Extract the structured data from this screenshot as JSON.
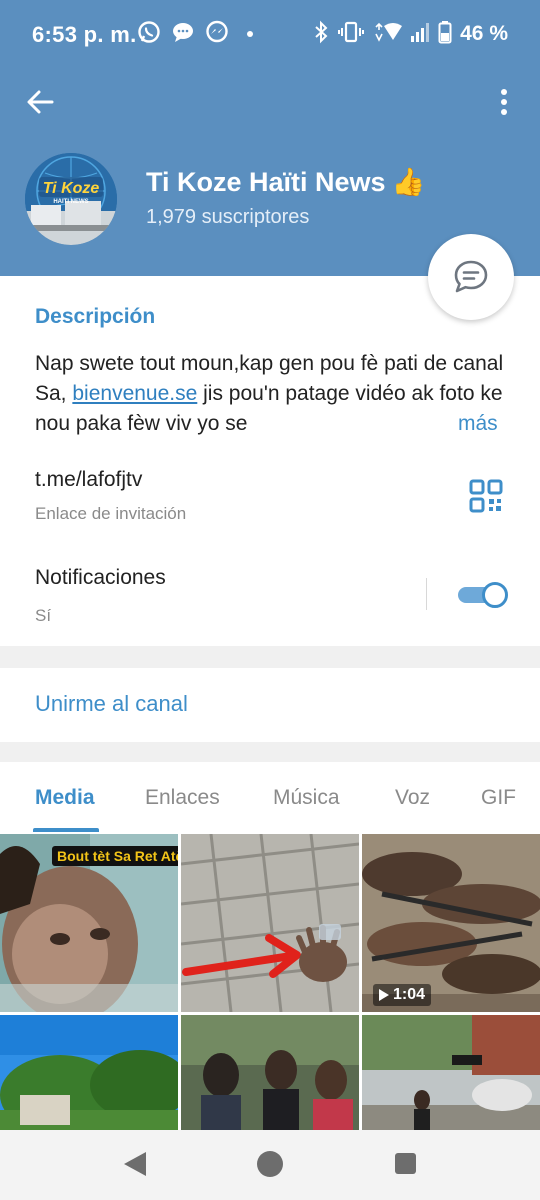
{
  "status_bar": {
    "time": "6:53 p. m.",
    "battery_percent": "46 %",
    "icons_left": [
      "whatsapp-icon",
      "chat-bubble-icon",
      "messenger-icon",
      "notification-dot"
    ],
    "icons_right": [
      "bluetooth-icon",
      "vibrate-icon",
      "wifi-icon",
      "signal-icon",
      "battery-icon"
    ]
  },
  "header": {
    "channel_name": "Ti Koze Haïti News",
    "channel_emoji": "👍",
    "subscribers": "1,979 suscriptores",
    "avatar_text": "Ti Koze",
    "avatar_subtext": "HAITI NEWS",
    "color": "#5b8fbf"
  },
  "description": {
    "label": "Descripción",
    "text_before_link": "Nap swete tout moun,kap gen pou fè pati de canal Sa, ",
    "link_text": "bienvenue.se",
    "text_after_link": " jis pou'n patage vidéo ak foto ke nou paka fèw viv yo se",
    "more": "más"
  },
  "invite": {
    "link": "t.me/lafofjtv",
    "label": "Enlace de invitación"
  },
  "notifications": {
    "title": "Notificaciones",
    "value": "Sí",
    "enabled": true
  },
  "join": {
    "label": "Unirme al canal"
  },
  "tabs": [
    {
      "label": "Media",
      "active": true
    },
    {
      "label": "Enlaces",
      "active": false
    },
    {
      "label": "Música",
      "active": false
    },
    {
      "label": "Voz",
      "active": false
    },
    {
      "label": "GIF",
      "active": false
    }
  ],
  "media": {
    "items": [
      {
        "kind": "photo",
        "badge": "Bout tèt Sa Ret Atè"
      },
      {
        "kind": "photo"
      },
      {
        "kind": "video",
        "duration": "1:04"
      },
      {
        "kind": "photo"
      },
      {
        "kind": "photo"
      },
      {
        "kind": "photo"
      }
    ]
  },
  "accent_color": "#3e8ec9"
}
